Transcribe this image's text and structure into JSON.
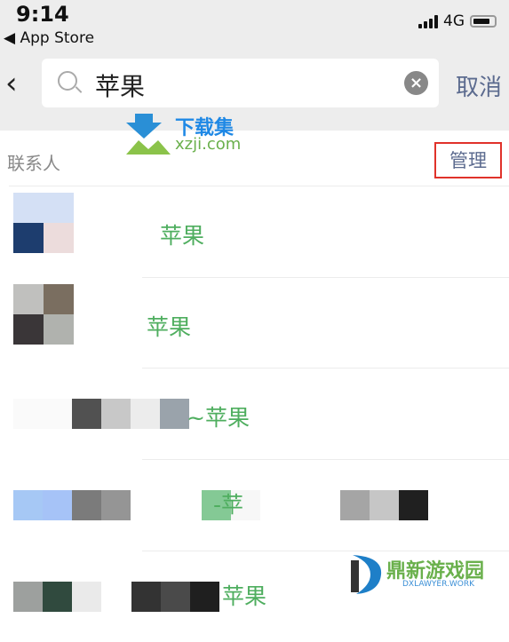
{
  "status_bar": {
    "time": "9:14",
    "back_app": "◀ App Store",
    "network": "4G"
  },
  "search": {
    "query": "苹果",
    "cancel_label": "取消"
  },
  "section": {
    "title": "联系人",
    "manage_label": "管理"
  },
  "accent": {
    "match_text": "#4fae5f",
    "link": "#5c6b8f",
    "highlight_box": "#e0322a"
  },
  "results": [
    {
      "name_visible": "苹果",
      "avatar": [
        "#d4e0f5",
        "#d4e0f5",
        "#1d3d6e",
        "#ecdcdc"
      ]
    },
    {
      "name_visible": "苹果",
      "avatar": [
        "#c0c0be",
        "#7a6e60",
        "#3a3638",
        "#b0b2ae"
      ]
    },
    {
      "name_visible": "~苹果",
      "blocks": [
        "#fafafa",
        "#fafafa",
        "#515151",
        "#c8c8c8",
        "#ececec",
        "#9aa3ab"
      ]
    },
    {
      "name_visible": "-苹",
      "blocks": [
        "#a6c8f5",
        "#a6c3f7",
        "#7b7b7b",
        "#959595"
      ],
      "blocks2": [
        "#84c995",
        "#f7f7f7"
      ],
      "blocks3": [
        "#a5a5a5",
        "#c6c6c6",
        "#202020"
      ]
    },
    {
      "name_visible": "苹果",
      "blocks": [
        "#9da09e",
        "#304a3e",
        "#eaeaea"
      ],
      "blocks2": [
        "#333333",
        "#4a4a4a",
        "#1f1f1f"
      ]
    }
  ],
  "watermarks": {
    "top_logo": "下载集",
    "top_url": "xzji.com",
    "bottom_logo": "鼎新游戏园",
    "bottom_url": "DXLAWYER.WORK"
  }
}
